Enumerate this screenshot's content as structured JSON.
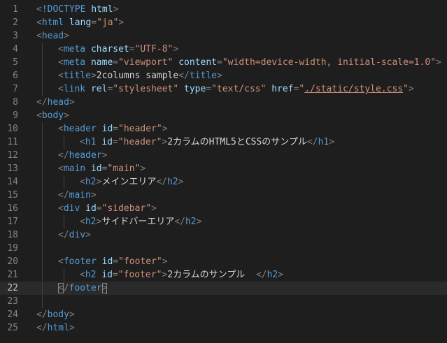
{
  "editor": {
    "language": "html",
    "current_line": 22,
    "lines": [
      {
        "n": "1",
        "indent": 0,
        "tokens": [
          [
            "t",
            "<"
          ],
          [
            "tn",
            "!DOCTYPE"
          ],
          [
            "tx",
            " "
          ],
          [
            "an",
            "html"
          ],
          [
            "t",
            ">"
          ]
        ]
      },
      {
        "n": "2",
        "indent": 0,
        "tokens": [
          [
            "t",
            "<"
          ],
          [
            "tn",
            "html"
          ],
          [
            "tx",
            " "
          ],
          [
            "an",
            "lang"
          ],
          [
            "t",
            "="
          ],
          [
            "av",
            "\"ja\""
          ],
          [
            "t",
            ">"
          ]
        ]
      },
      {
        "n": "3",
        "indent": 0,
        "tokens": [
          [
            "t",
            "<"
          ],
          [
            "tn",
            "head"
          ],
          [
            "t",
            ">"
          ]
        ]
      },
      {
        "n": "4",
        "indent": 1,
        "tokens": [
          [
            "t",
            "<"
          ],
          [
            "tn",
            "meta"
          ],
          [
            "tx",
            " "
          ],
          [
            "an",
            "charset"
          ],
          [
            "t",
            "="
          ],
          [
            "av",
            "\"UTF-8\""
          ],
          [
            "t",
            ">"
          ]
        ]
      },
      {
        "n": "5",
        "indent": 1,
        "tokens": [
          [
            "t",
            "<"
          ],
          [
            "tn",
            "meta"
          ],
          [
            "tx",
            " "
          ],
          [
            "an",
            "name"
          ],
          [
            "t",
            "="
          ],
          [
            "av",
            "\"viewport\""
          ],
          [
            "tx",
            " "
          ],
          [
            "an",
            "content"
          ],
          [
            "t",
            "="
          ],
          [
            "av",
            "\"width=device-width, initial-scale=1.0\""
          ],
          [
            "t",
            ">"
          ]
        ]
      },
      {
        "n": "6",
        "indent": 1,
        "tokens": [
          [
            "t",
            "<"
          ],
          [
            "tn",
            "title"
          ],
          [
            "t",
            ">"
          ],
          [
            "tx",
            "2columns sample"
          ],
          [
            "t",
            "</"
          ],
          [
            "tn",
            "title"
          ],
          [
            "t",
            ">"
          ]
        ]
      },
      {
        "n": "7",
        "indent": 1,
        "tokens": [
          [
            "t",
            "<"
          ],
          [
            "tn",
            "link"
          ],
          [
            "tx",
            " "
          ],
          [
            "an",
            "rel"
          ],
          [
            "t",
            "="
          ],
          [
            "av",
            "\"stylesheet\""
          ],
          [
            "tx",
            " "
          ],
          [
            "an",
            "type"
          ],
          [
            "t",
            "="
          ],
          [
            "av",
            "\"text/css\""
          ],
          [
            "tx",
            " "
          ],
          [
            "an",
            "href"
          ],
          [
            "t",
            "="
          ],
          [
            "av",
            "\""
          ],
          [
            "av_u",
            "./static/style.css"
          ],
          [
            "av",
            "\""
          ],
          [
            "t",
            ">"
          ]
        ]
      },
      {
        "n": "8",
        "indent": 0,
        "tokens": [
          [
            "t",
            "</"
          ],
          [
            "tn",
            "head"
          ],
          [
            "t",
            ">"
          ]
        ]
      },
      {
        "n": "9",
        "indent": 0,
        "tokens": [
          [
            "t",
            "<"
          ],
          [
            "tn",
            "body"
          ],
          [
            "t",
            ">"
          ]
        ]
      },
      {
        "n": "10",
        "indent": 1,
        "tokens": [
          [
            "t",
            "<"
          ],
          [
            "tn",
            "header"
          ],
          [
            "tx",
            " "
          ],
          [
            "an",
            "id"
          ],
          [
            "t",
            "="
          ],
          [
            "av",
            "\"header\""
          ],
          [
            "t",
            ">"
          ]
        ]
      },
      {
        "n": "11",
        "indent": 2,
        "tokens": [
          [
            "t",
            "<"
          ],
          [
            "tn",
            "h1"
          ],
          [
            "tx",
            " "
          ],
          [
            "an",
            "id"
          ],
          [
            "t",
            "="
          ],
          [
            "av",
            "\"header\""
          ],
          [
            "t",
            ">"
          ],
          [
            "tx",
            "2カラムのHTML5とCSSのサンプル"
          ],
          [
            "t",
            "</"
          ],
          [
            "tn",
            "h1"
          ],
          [
            "t",
            ">"
          ]
        ]
      },
      {
        "n": "12",
        "indent": 1,
        "tokens": [
          [
            "t",
            "</"
          ],
          [
            "tn",
            "header"
          ],
          [
            "t",
            ">"
          ]
        ]
      },
      {
        "n": "13",
        "indent": 1,
        "tokens": [
          [
            "t",
            "<"
          ],
          [
            "tn",
            "main"
          ],
          [
            "tx",
            " "
          ],
          [
            "an",
            "id"
          ],
          [
            "t",
            "="
          ],
          [
            "av",
            "\"main\""
          ],
          [
            "t",
            ">"
          ]
        ]
      },
      {
        "n": "14",
        "indent": 2,
        "tokens": [
          [
            "t",
            "<"
          ],
          [
            "tn",
            "h2"
          ],
          [
            "t",
            ">"
          ],
          [
            "tx",
            "メインエリア"
          ],
          [
            "t",
            "</"
          ],
          [
            "tn",
            "h2"
          ],
          [
            "t",
            ">"
          ]
        ]
      },
      {
        "n": "15",
        "indent": 1,
        "tokens": [
          [
            "t",
            "</"
          ],
          [
            "tn",
            "main"
          ],
          [
            "t",
            ">"
          ]
        ]
      },
      {
        "n": "16",
        "indent": 1,
        "tokens": [
          [
            "t",
            "<"
          ],
          [
            "tn",
            "div"
          ],
          [
            "tx",
            " "
          ],
          [
            "an",
            "id"
          ],
          [
            "t",
            "="
          ],
          [
            "av",
            "\"sidebar\""
          ],
          [
            "t",
            ">"
          ]
        ]
      },
      {
        "n": "17",
        "indent": 2,
        "tokens": [
          [
            "t",
            "<"
          ],
          [
            "tn",
            "h2"
          ],
          [
            "t",
            ">"
          ],
          [
            "tx",
            "サイドバーエリア"
          ],
          [
            "t",
            "</"
          ],
          [
            "tn",
            "h2"
          ],
          [
            "t",
            ">"
          ]
        ]
      },
      {
        "n": "18",
        "indent": 1,
        "tokens": [
          [
            "t",
            "</"
          ],
          [
            "tn",
            "div"
          ],
          [
            "t",
            ">"
          ]
        ]
      },
      {
        "n": "19",
        "indent": 1,
        "tokens": []
      },
      {
        "n": "20",
        "indent": 1,
        "tokens": [
          [
            "t",
            "<"
          ],
          [
            "tn",
            "footer"
          ],
          [
            "tx",
            " "
          ],
          [
            "an",
            "id"
          ],
          [
            "t",
            "="
          ],
          [
            "av",
            "\"footer\""
          ],
          [
            "t",
            ">"
          ]
        ]
      },
      {
        "n": "21",
        "indent": 2,
        "tokens": [
          [
            "t",
            "<"
          ],
          [
            "tn",
            "h2"
          ],
          [
            "tx",
            " "
          ],
          [
            "an",
            "id"
          ],
          [
            "t",
            "="
          ],
          [
            "av",
            "\"footer\""
          ],
          [
            "t",
            ">"
          ],
          [
            "tx",
            "2カラムのサンプル  "
          ],
          [
            "t",
            "</"
          ],
          [
            "tn",
            "h2"
          ],
          [
            "t",
            ">"
          ]
        ]
      },
      {
        "n": "22",
        "indent": 1,
        "tokens": [
          [
            "t_bm",
            "<"
          ],
          [
            "t",
            "/"
          ],
          [
            "tn",
            "footer"
          ],
          [
            "t_bm",
            ">"
          ],
          [
            "cursor",
            ""
          ]
        ]
      },
      {
        "n": "23",
        "indent": 1,
        "tokens": []
      },
      {
        "n": "24",
        "indent": 0,
        "tokens": [
          [
            "t",
            "</"
          ],
          [
            "tn",
            "body"
          ],
          [
            "t",
            ">"
          ]
        ]
      },
      {
        "n": "25",
        "indent": 0,
        "tokens": [
          [
            "t",
            "</"
          ],
          [
            "tn",
            "html"
          ],
          [
            "t",
            ">"
          ]
        ]
      }
    ]
  }
}
